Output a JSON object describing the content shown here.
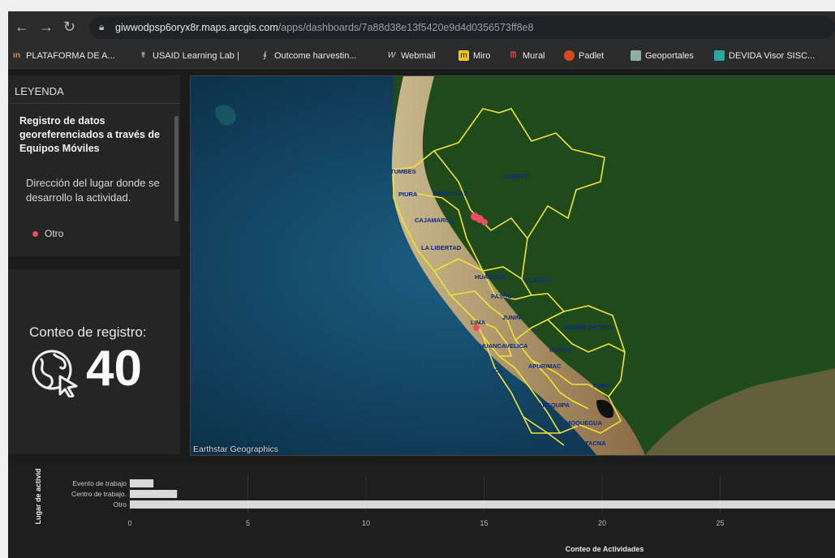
{
  "browser": {
    "url_host": "giwwodpsp6oryx8r.maps.arcgis.com",
    "url_path": "/apps/dashboards/7a88d38e13f5420e9d4d0356573ff8e8",
    "bookmarks": [
      {
        "label": "PLATAFORMA DE A...",
        "icon": "plataforma-icon"
      },
      {
        "label": "USAID Learning Lab |",
        "icon": "usaid-icon"
      },
      {
        "label": "Outcome harvestin...",
        "icon": "outcome-icon"
      },
      {
        "label": "Webmail",
        "icon": "webmail-icon"
      },
      {
        "label": "Miro",
        "icon": "miro-icon"
      },
      {
        "label": "Mural",
        "icon": "mural-icon"
      },
      {
        "label": "Padlet",
        "icon": "padlet-icon"
      },
      {
        "label": "Geoportales",
        "icon": "geoportales-icon"
      },
      {
        "label": "DEVIDA Visor SISC...",
        "icon": "devida-icon"
      }
    ]
  },
  "legend": {
    "header": "LEYENDA",
    "layer_title": "Registro de datos georeferenciados a través de Equipos Móviles",
    "field_title": "Dirección del lugar donde se desarrollo la actividad.",
    "items": [
      {
        "label": "Otro",
        "color": "#e84f5c"
      }
    ]
  },
  "counter": {
    "title": "Conteo de registro:",
    "value": "40",
    "icon": "globe-cursor-icon"
  },
  "map": {
    "attribution": "Earthstar Geographics",
    "departments": [
      "TUMBES",
      "PIURA",
      "AMAZONAS",
      "LORETO",
      "CAJAMARCA",
      "LA LIBERTAD",
      "HUANUCO",
      "UCAYALI",
      "PASCO",
      "LIMA",
      "JUNIN",
      "MADRE DE DIOS",
      "HUANCAVELICA",
      "CUSCO",
      "ICA",
      "APURIMAC",
      "PUNO",
      "AREQUIPA",
      "MOQUEGUA",
      "TACNA"
    ]
  },
  "chart_data": {
    "type": "bar",
    "orientation": "horizontal",
    "categories": [
      "Evento de trabajo",
      "Centro de trabajo.",
      "Otro"
    ],
    "values": [
      1,
      2,
      37
    ],
    "xlabel": "Conteo de Actividades",
    "ylabel": "Lugar de activid",
    "xticks": [
      0,
      5,
      10,
      15,
      20,
      25
    ],
    "bar_color": "#d9d9d9"
  }
}
